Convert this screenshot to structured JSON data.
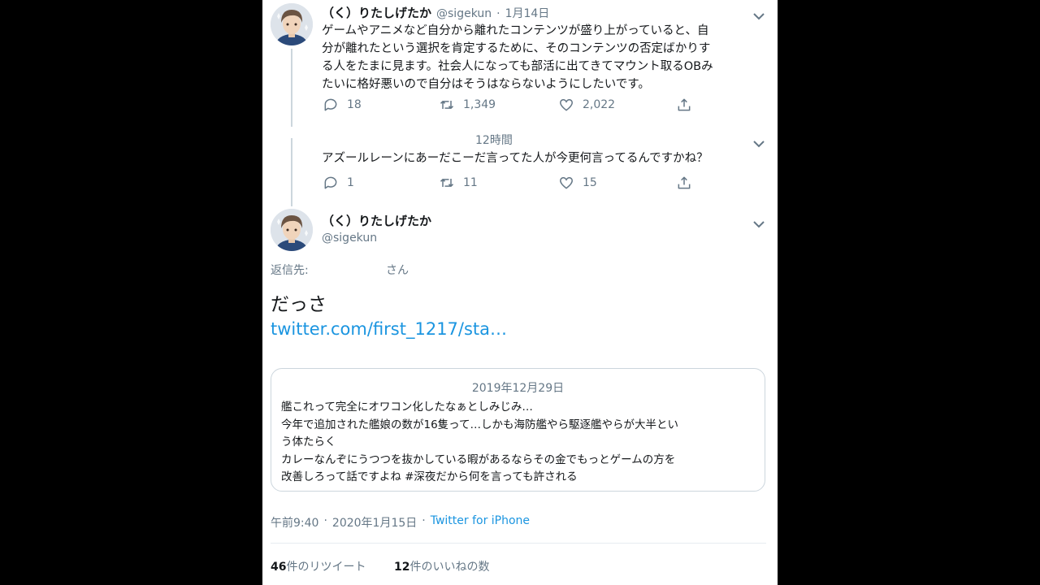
{
  "tweet1": {
    "display_name": "（く）りたしげたか",
    "handle": "@sigekun",
    "sep": "·",
    "date": "1月14日",
    "text_lines": [
      "ゲームやアニメなど自分から離れたコンテンツが盛り上がっていると、自",
      "分が離れたという選択を肯定するために、そのコンテンツの否定ばかりす",
      "る人をたまに見ます。社会人になっても部活に出てきてマウント取るOBみ",
      "たいに格好悪いので自分はそうはならないようにしたいです。"
    ],
    "replies": "18",
    "retweets": "1,349",
    "likes": "2,022"
  },
  "tweet2": {
    "time": "12時間",
    "text": "アズールレーンにあーだこーだ言ってた人が今更何言ってるんですかね？",
    "replies": "1",
    "retweets": "11",
    "likes": "15"
  },
  "main": {
    "display_name": "（く）りたしげたか",
    "handle": "@sigekun",
    "reply_to_label": "返信先:",
    "reply_to_suffix": "さん",
    "text": "だっさ",
    "link": "twitter.com/first_1217/sta…",
    "quote": {
      "date": "2019年12月29日",
      "lines": [
        "艦これって完全にオワコン化したなぁとしみじみ…",
        "今年で追加された艦娘の数が16隻って…しかも海防艦やら駆逐艦やらが大半とい",
        "う体たらく",
        "カレーなんぞにうつつを抜かしている暇があるならその金でもっとゲームの方を",
        "改善しろって話ですよね #深夜だから何を言っても許される"
      ]
    },
    "time": "午前9:40",
    "sep1": "·",
    "date": "2020年1月15日",
    "sep2": "·",
    "client": "Twitter for iPhone",
    "retweet_count": "46",
    "retweet_label": "件のリツイート",
    "like_count": "12",
    "like_label": "件のいいねの数"
  },
  "icons": {
    "caret": "chevron-down-icon",
    "reply": "reply-icon",
    "retweet": "retweet-icon",
    "like": "heart-icon",
    "share": "share-icon"
  },
  "colors": {
    "background": "#000000",
    "panel": "#ffffff",
    "text": "#14171a",
    "muted": "#657786",
    "link": "#1b95e0",
    "border": "#ccd6dd"
  }
}
